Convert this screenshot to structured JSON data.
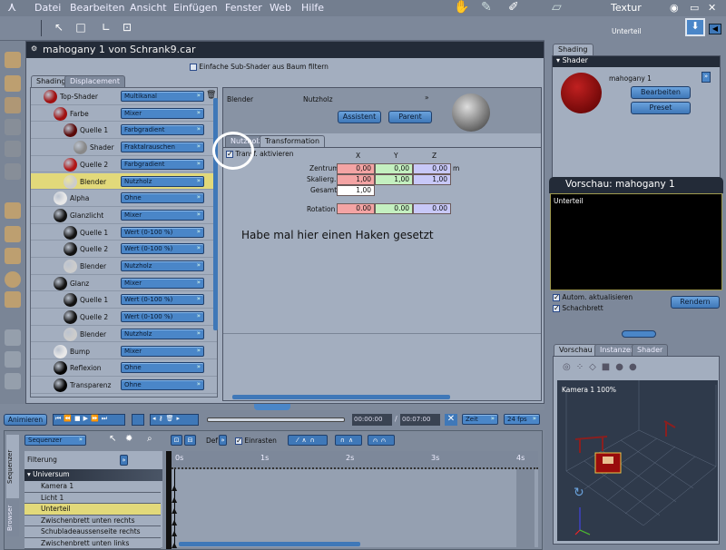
{
  "menu": [
    "Datei",
    "Bearbeiten",
    "Ansicht",
    "Einfügen",
    "Fenster",
    "Web",
    "Hilfe"
  ],
  "window": {
    "title": "mahogany 1 von Schrank9.car",
    "filter_label": "Einfache Sub-Shader aus Baum filtern",
    "filter_checked": false
  },
  "tabs": {
    "shading": "Shading",
    "displacement": "Displacement"
  },
  "tree": [
    {
      "label": "Top-Shader",
      "type": "Multikanal",
      "depth": 0,
      "color": "#a01010"
    },
    {
      "label": "Farbe",
      "type": "Mixer",
      "depth": 1,
      "color": "#a01010"
    },
    {
      "label": "Quelle 1",
      "type": "Farbgradient",
      "depth": 2,
      "color": "#5a0a0a"
    },
    {
      "label": "Shader",
      "type": "Fraktalrauschen",
      "depth": 3,
      "color": "#888888"
    },
    {
      "label": "Quelle 2",
      "type": "Farbgradient",
      "depth": 2,
      "color": "#b01515"
    },
    {
      "label": "Blender",
      "type": "Nutzholz",
      "depth": 2,
      "color": "#cccccc",
      "selected": true
    },
    {
      "label": "Alpha",
      "type": "Ohne",
      "depth": 1,
      "color": "#e8e8e8"
    },
    {
      "label": "Glanzlicht",
      "type": "Mixer",
      "depth": 1,
      "color": "#111111"
    },
    {
      "label": "Quelle 1",
      "type": "Wert (0-100 %)",
      "depth": 2,
      "color": "#111111"
    },
    {
      "label": "Quelle 2",
      "type": "Wert (0-100 %)",
      "depth": 2,
      "color": "#111111"
    },
    {
      "label": "Blender",
      "type": "Nutzholz",
      "depth": 2,
      "color": "#cccccc"
    },
    {
      "label": "Glanz",
      "type": "Mixer",
      "depth": 1,
      "color": "#111111"
    },
    {
      "label": "Quelle 1",
      "type": "Wert (0-100 %)",
      "depth": 2,
      "color": "#111111"
    },
    {
      "label": "Quelle 2",
      "type": "Wert (0-100 %)",
      "depth": 2,
      "color": "#111111"
    },
    {
      "label": "Blender",
      "type": "Nutzholz",
      "depth": 2,
      "color": "#cccccc"
    },
    {
      "label": "Bump",
      "type": "Mixer",
      "depth": 1,
      "color": "#e8e8e8"
    },
    {
      "label": "Reflexion",
      "type": "Ohne",
      "depth": 1,
      "color": "#050505"
    },
    {
      "label": "Transparenz",
      "type": "Ohne",
      "depth": 1,
      "color": "#050505"
    }
  ],
  "detail": {
    "name": "Blender",
    "type": "Nutzholz",
    "assistent": "Assistent",
    "parent": "Parent",
    "tab_nutzholz": "Nutzholz",
    "tab_transformation": "Transformation",
    "transf_label": "Transf. aktivieren",
    "transf_checked": true,
    "cols": [
      "X",
      "Y",
      "Z"
    ],
    "zentrum": {
      "label": "Zentrum",
      "x": "0,00",
      "y": "0,00",
      "z": "0,00",
      "unit": "m"
    },
    "skalierg": {
      "label": "Skalierg.",
      "x": "1,00",
      "y": "1,00",
      "z": "1,00"
    },
    "gesamt": {
      "label": "Gesamt",
      "value": "1,00"
    },
    "rotation": {
      "label": "Rotation",
      "x": "0.00",
      "y": "0.00",
      "z": "0.00"
    }
  },
  "annotation": "Habe mal hier einen Haken gesetzt",
  "right": {
    "title": "Textur",
    "object": "Unterteil",
    "tab": "Shading",
    "section": "Shader",
    "shader_name": "mahogany 1",
    "edit": "Bearbeiten",
    "preset": "Preset",
    "preview_title": "Vorschau: mahogany 1",
    "preview_object": "Unterteil",
    "auto_update": "Autom. aktualisieren",
    "checker": "Schachbrett",
    "render": "Rendern",
    "tabs": [
      "Vorschau",
      "Instanzen",
      "Shader"
    ],
    "camera": "Kamera 1 100%"
  },
  "anim": {
    "animate": "Animieren",
    "time_current": "00:00:00",
    "time_total": "00:07:00",
    "mode": "Zeit",
    "fps": "24 fps"
  },
  "seq": {
    "mode": "Sequenzer",
    "filter": "Filterung",
    "def": "Def",
    "snap": "Einrasten",
    "snap_checked": true,
    "side_tabs": [
      "Sequenzer",
      "Browser"
    ],
    "ticks": [
      "0s",
      "1s",
      "2s",
      "3s",
      "4s"
    ],
    "root": "Universum",
    "items": [
      "Kamera 1",
      "Licht 1",
      "Unterteil",
      "Zwischenbrett unten rechts",
      "Schubladeaussenseite rechts",
      "Zwischenbrett unten links"
    ],
    "selected_item": "Unterteil"
  },
  "colors": {
    "accent": "#3f78b8",
    "selection": "#e2d97a",
    "titlebar": "#232b38"
  }
}
